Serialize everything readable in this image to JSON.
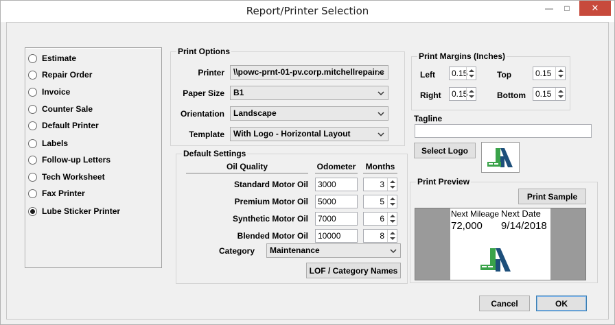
{
  "window": {
    "title": "Report/Printer Selection",
    "close_glyph": "✕",
    "minimize_glyph": "—",
    "maximize_glyph": "□"
  },
  "report_types": {
    "selected_index": 9,
    "items": [
      {
        "label": "Estimate"
      },
      {
        "label": "Repair Order"
      },
      {
        "label": "Invoice"
      },
      {
        "label": "Counter Sale"
      },
      {
        "label": "Default Printer"
      },
      {
        "label": "Labels"
      },
      {
        "label": "Follow-up Letters"
      },
      {
        "label": "Tech Worksheet"
      },
      {
        "label": "Fax Printer"
      },
      {
        "label": "Lube Sticker Printer"
      }
    ]
  },
  "print_options": {
    "legend": "Print Options",
    "printer_label": "Printer",
    "printer_value": "\\\\powc-prnt-01-pv.corp.mitchellrepair.c",
    "paper_size_label": "Paper Size",
    "paper_size_value": "B1",
    "orientation_label": "Orientation",
    "orientation_value": "Landscape",
    "template_label": "Template",
    "template_value": "With Logo - Horizontal Layout"
  },
  "default_settings": {
    "legend": "Default Settings",
    "col_oil_quality": "Oil Quality",
    "col_odometer": "Odometer",
    "col_months": "Months",
    "rows": [
      {
        "label": "Standard Motor Oil",
        "odometer": "3000",
        "months": "3"
      },
      {
        "label": "Premium Motor Oil",
        "odometer": "5000",
        "months": "5"
      },
      {
        "label": "Synthetic Motor Oil",
        "odometer": "7000",
        "months": "6"
      },
      {
        "label": "Blended Motor Oil",
        "odometer": "10000",
        "months": "8"
      }
    ],
    "category_label": "Category",
    "category_value": "Maintenance",
    "lof_button": "LOF / Category Names"
  },
  "margins": {
    "legend": "Print Margins (Inches)",
    "left_label": "Left",
    "left_value": "0.15",
    "top_label": "Top",
    "top_value": "0.15",
    "right_label": "Right",
    "right_value": "0.15",
    "bottom_label": "Bottom",
    "bottom_value": "0.15"
  },
  "tagline": {
    "label": "Tagline",
    "value": ""
  },
  "logo": {
    "select_button": "Select Logo"
  },
  "preview": {
    "legend": "Print Preview",
    "print_sample_button": "Print Sample",
    "next_mileage_label": "Next Mileage",
    "next_mileage_value": "72,000",
    "next_date_label": "Next Date",
    "next_date_value": "9/14/2018"
  },
  "footer": {
    "cancel": "Cancel",
    "ok": "OK"
  },
  "colors": {
    "logo_green": "#3aa34a",
    "logo_blue": "#1d4f7a",
    "close_red": "#c74a3c"
  }
}
